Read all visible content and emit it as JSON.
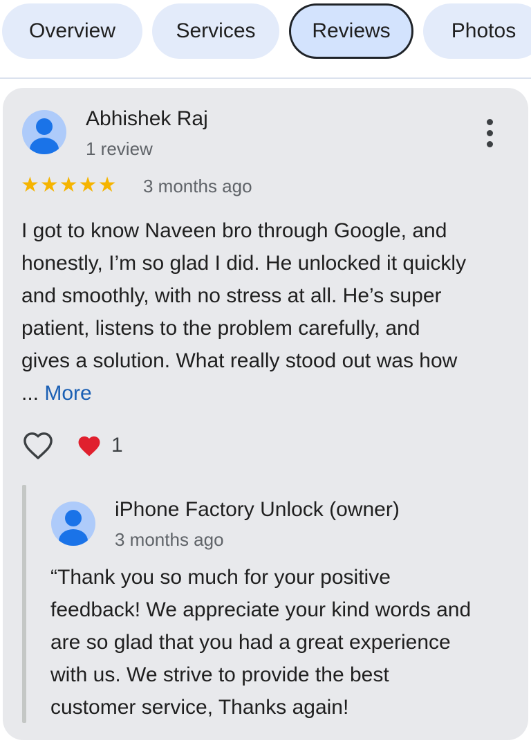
{
  "tabs": [
    {
      "label": "Overview",
      "active": false
    },
    {
      "label": "Services",
      "active": false
    },
    {
      "label": "Reviews",
      "active": true
    },
    {
      "label": "Photos",
      "active": false
    }
  ],
  "review": {
    "author": "Abhishek Raj",
    "author_meta": "1 review",
    "rating": 5,
    "rating_stars": "★★★★★",
    "time": "3 months ago",
    "lines": [
      "I got to know Naveen bro through Google, and",
      "honestly, I’m so glad I did. He unlocked it quickly",
      "and smoothly, with no stress at all. He’s super",
      "patient, listens to the problem carefully, and",
      "gives a solution. What really stood out was how"
    ],
    "ellipsis": "...",
    "more_label": "More",
    "reaction_count": "1",
    "reaction_emoji": "❤️"
  },
  "reply": {
    "author": "iPhone Factory Unlock (owner)",
    "time": "3 months ago",
    "lines": [
      "“Thank you so much for your positive",
      "feedback! We appreciate your kind words and",
      "are so glad that you had a great experience",
      "with us. We strive to provide the best",
      "customer service, Thanks again!"
    ]
  },
  "colors": {
    "accent": "#1a73e8",
    "star": "#f5b400",
    "link": "#1a5fb4",
    "card_bg": "#e8e9ec",
    "tab_bg": "#e3ebfa"
  },
  "icons": [
    "person-avatar-icon",
    "star-icon",
    "more-vert-icon",
    "heart-outline-icon",
    "heart-emoji-icon"
  ]
}
